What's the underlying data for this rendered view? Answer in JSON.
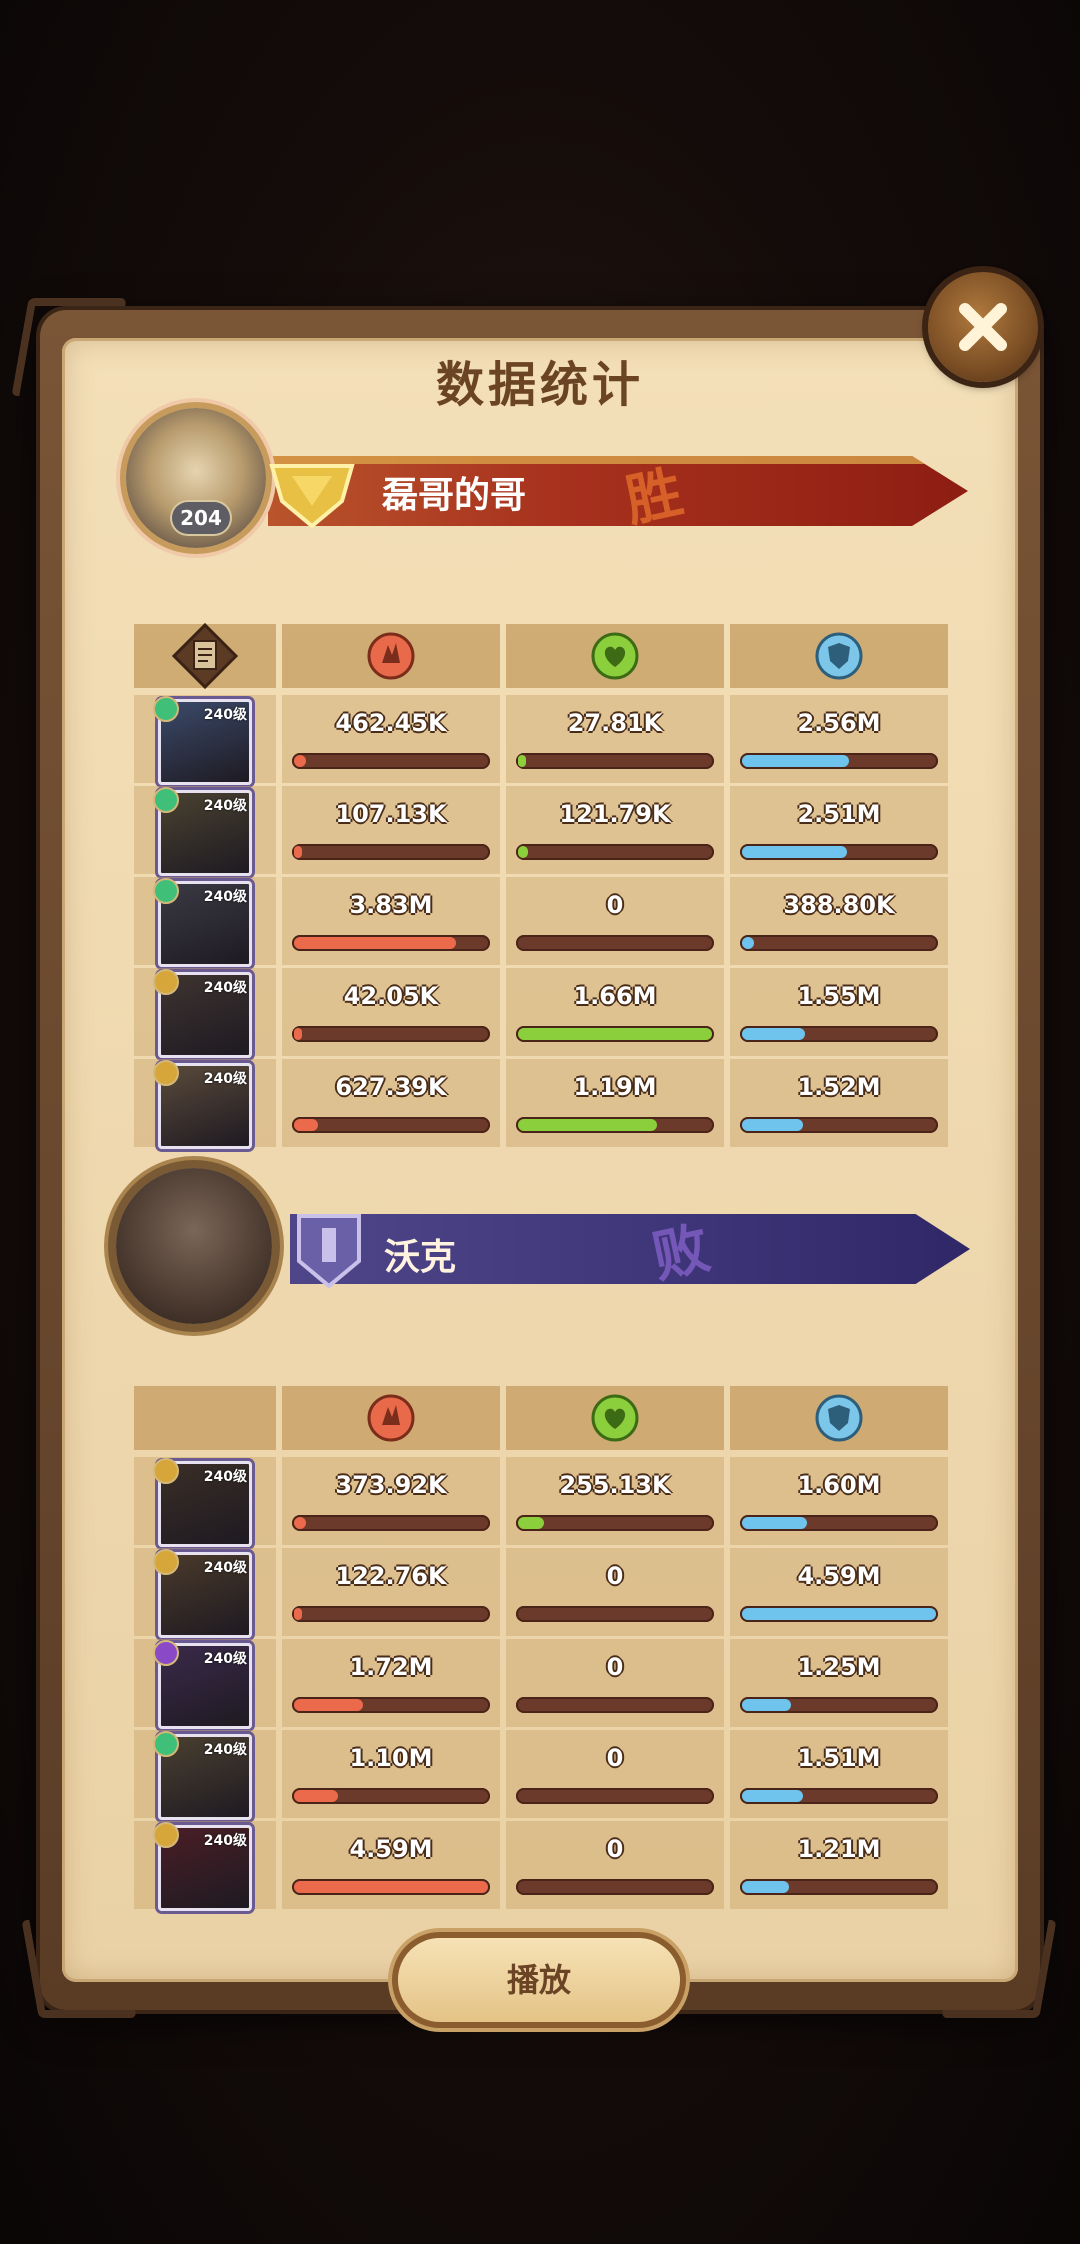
{
  "title": "数据统计",
  "play_label": "播放",
  "colors": {
    "damage": "#ec6a4c",
    "heal": "#8ccf3c",
    "shield": "#6ec4ec"
  },
  "winner": {
    "name": "磊哥的哥",
    "result": "胜",
    "avatar_level": "204",
    "heroes": [
      {
        "level": "240级",
        "damage": "462.45K",
        "damage_pct": 0.08,
        "heal": "27.81K",
        "heal_pct": 0.02,
        "shield": "2.56M",
        "shield_pct": 0.56
      },
      {
        "level": "240级",
        "damage": "107.13K",
        "damage_pct": 0.03,
        "heal": "121.79K",
        "heal_pct": 0.07,
        "shield": "2.51M",
        "shield_pct": 0.55
      },
      {
        "level": "240级",
        "damage": "3.83M",
        "damage_pct": 0.84,
        "heal": "0",
        "heal_pct": 0,
        "shield": "388.80K",
        "shield_pct": 0.08
      },
      {
        "level": "240级",
        "damage": "42.05K",
        "damage_pct": 0.02,
        "heal": "1.66M",
        "heal_pct": 1.0,
        "shield": "1.55M",
        "shield_pct": 0.34
      },
      {
        "level": "240级",
        "damage": "627.39K",
        "damage_pct": 0.14,
        "heal": "1.19M",
        "heal_pct": 0.72,
        "shield": "1.52M",
        "shield_pct": 0.33
      }
    ]
  },
  "loser": {
    "name": "沃克",
    "result": "败",
    "heroes": [
      {
        "level": "240级",
        "damage": "373.92K",
        "damage_pct": 0.08,
        "heal": "255.13K",
        "heal_pct": 0.15,
        "shield": "1.60M",
        "shield_pct": 0.35
      },
      {
        "level": "240级",
        "damage": "122.76K",
        "damage_pct": 0.03,
        "heal": "0",
        "heal_pct": 0,
        "shield": "4.59M",
        "shield_pct": 1.0
      },
      {
        "level": "240级",
        "damage": "1.72M",
        "damage_pct": 0.37,
        "heal": "0",
        "heal_pct": 0,
        "shield": "1.25M",
        "shield_pct": 0.27
      },
      {
        "level": "240级",
        "damage": "1.10M",
        "damage_pct": 0.24,
        "heal": "0",
        "heal_pct": 0,
        "shield": "1.51M",
        "shield_pct": 0.33
      },
      {
        "level": "240级",
        "damage": "4.59M",
        "damage_pct": 1.0,
        "heal": "0",
        "heal_pct": 0,
        "shield": "1.21M",
        "shield_pct": 0.26
      }
    ]
  }
}
